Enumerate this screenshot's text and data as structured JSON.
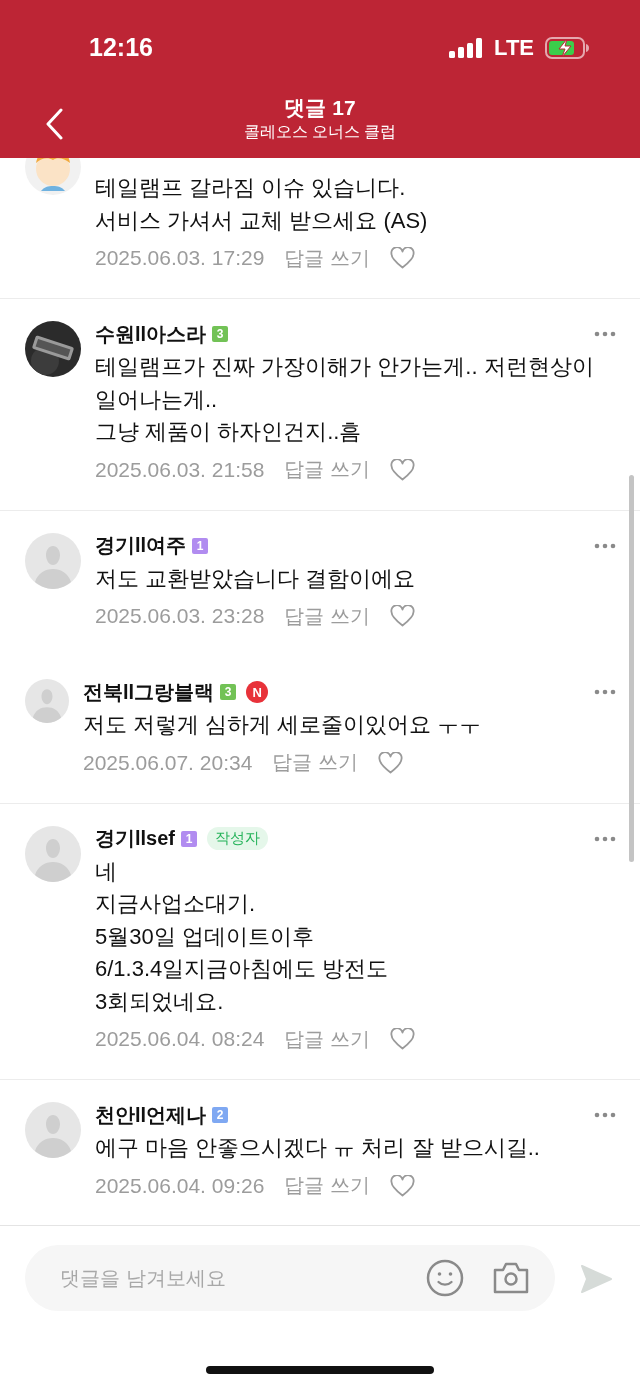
{
  "status_bar": {
    "time": "12:16",
    "network": "LTE"
  },
  "header": {
    "title": "댓글 17",
    "subtitle": "콜레오스 오너스 클럽"
  },
  "comments": [
    {
      "avatar": {
        "kind": "cartoon"
      },
      "text": "테일램프 갈라짐 이슈 있습니다.\n서비스 가셔서 교체 받으세요 (AS)",
      "date": "2025.06.03. 17:29",
      "reply_label": "답글 쓰기"
    },
    {
      "author": "수원ll아스라",
      "level": {
        "text": "3",
        "color": "#72c256"
      },
      "text": "테일램프가 진짜 가장이해가 안가는게.. 저런현상이\n일어나는게..\n그냥 제품이 하자인건지..흠",
      "date": "2025.06.03. 21:58",
      "reply_label": "답글 쓰기"
    },
    {
      "avatar": {
        "kind": "default"
      },
      "author": "경기ll여주",
      "level": {
        "text": "1",
        "color": "#b18cf0"
      },
      "text": "저도 교환받았습니다 결함이에요",
      "date": "2025.06.03. 23:28",
      "reply_label": "답글 쓰기",
      "replies": [
        {
          "avatar": {
            "kind": "default"
          },
          "author": "전북ll그랑블랙",
          "level": {
            "text": "3",
            "color": "#72c256"
          },
          "new_badge": "N",
          "text": "저도 저렇게 심하게 세로줄이있어요 ㅜㅜ",
          "date": "2025.06.07. 20:34",
          "reply_label": "답글 쓰기"
        }
      ]
    },
    {
      "avatar": {
        "kind": "default"
      },
      "author": "경기llsef",
      "level": {
        "text": "1",
        "color": "#b18cf0"
      },
      "author_tag": "작성자",
      "text": "네\n지금사업소대기.\n5월30일 업데이트이후\n6/1.3.4일지금아침에도 방전도\n3회되었네요.",
      "date": "2025.06.04. 08:24",
      "reply_label": "답글 쓰기"
    },
    {
      "avatar": {
        "kind": "default"
      },
      "author": "천안ll언제나",
      "level": {
        "text": "2",
        "color": "#7fa8f2"
      },
      "text": "에구 마음 안좋으시겠다 ㅠ 처리 잘 받으시길..",
      "date": "2025.06.04. 09:26",
      "reply_label": "답글 쓰기"
    }
  ],
  "composer": {
    "placeholder": "댓글을 남겨보세요"
  }
}
